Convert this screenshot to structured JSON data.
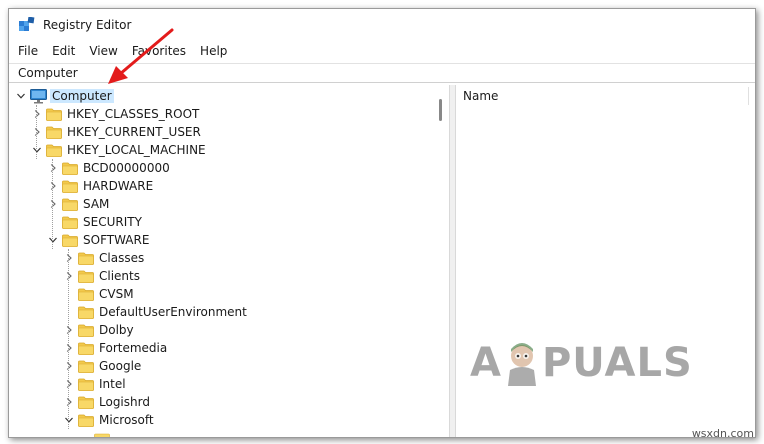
{
  "window": {
    "title": "Registry Editor",
    "icon": "registry-editor-icon"
  },
  "menu": [
    "File",
    "Edit",
    "View",
    "Favorites",
    "Help"
  ],
  "address": "Computer",
  "list_header": {
    "name": "Name"
  },
  "tree": [
    {
      "label": "Computer",
      "depth": 0,
      "expander": "expanded",
      "icon": "computer-icon",
      "selected": true
    },
    {
      "label": "HKEY_CLASSES_ROOT",
      "depth": 1,
      "expander": "collapsed",
      "icon": "folder-icon"
    },
    {
      "label": "HKEY_CURRENT_USER",
      "depth": 1,
      "expander": "collapsed",
      "icon": "folder-icon"
    },
    {
      "label": "HKEY_LOCAL_MACHINE",
      "depth": 1,
      "expander": "expanded",
      "icon": "folder-icon"
    },
    {
      "label": "BCD00000000",
      "depth": 2,
      "expander": "collapsed",
      "icon": "folder-icon"
    },
    {
      "label": "HARDWARE",
      "depth": 2,
      "expander": "collapsed",
      "icon": "folder-icon"
    },
    {
      "label": "SAM",
      "depth": 2,
      "expander": "collapsed",
      "icon": "folder-icon"
    },
    {
      "label": "SECURITY",
      "depth": 2,
      "expander": "none",
      "icon": "folder-icon"
    },
    {
      "label": "SOFTWARE",
      "depth": 2,
      "expander": "expanded",
      "icon": "folder-icon"
    },
    {
      "label": "Classes",
      "depth": 3,
      "expander": "collapsed",
      "icon": "folder-icon"
    },
    {
      "label": "Clients",
      "depth": 3,
      "expander": "collapsed",
      "icon": "folder-icon"
    },
    {
      "label": "CVSM",
      "depth": 3,
      "expander": "none",
      "icon": "folder-icon"
    },
    {
      "label": "DefaultUserEnvironment",
      "depth": 3,
      "expander": "none",
      "icon": "folder-icon"
    },
    {
      "label": "Dolby",
      "depth": 3,
      "expander": "collapsed",
      "icon": "folder-icon"
    },
    {
      "label": "Fortemedia",
      "depth": 3,
      "expander": "collapsed",
      "icon": "folder-icon"
    },
    {
      "label": "Google",
      "depth": 3,
      "expander": "collapsed",
      "icon": "folder-icon"
    },
    {
      "label": "Intel",
      "depth": 3,
      "expander": "collapsed",
      "icon": "folder-icon"
    },
    {
      "label": "Logishrd",
      "depth": 3,
      "expander": "collapsed",
      "icon": "folder-icon"
    },
    {
      "label": "Microsoft",
      "depth": 3,
      "expander": "expanded",
      "icon": "folder-icon"
    }
  ],
  "watermark": {
    "left": "A",
    "right": "PUALS"
  },
  "site": "wsxdn.com",
  "colors": {
    "folder": "#f2c94c",
    "folder_dark": "#d9a92a",
    "selection": "#cce8ff",
    "arrow": "#e31b1b",
    "monitor": "#2f86d1"
  }
}
